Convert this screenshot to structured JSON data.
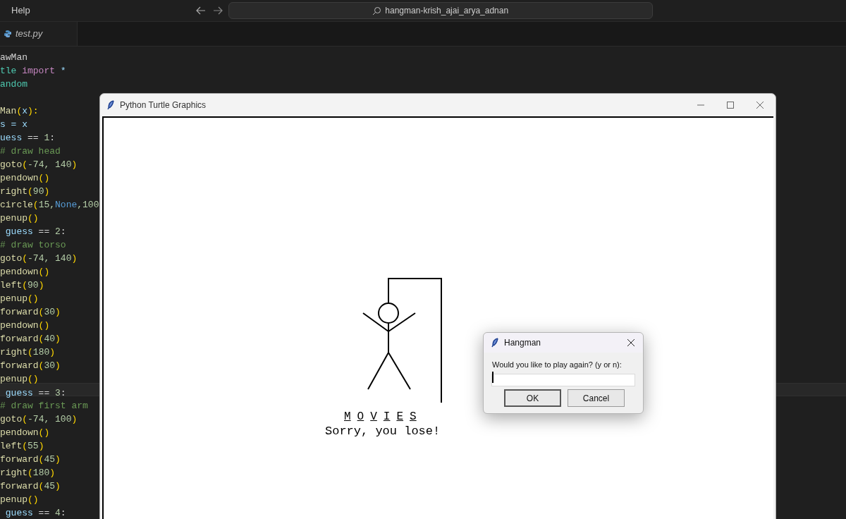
{
  "menu": {
    "items": [
      "Help"
    ]
  },
  "search": {
    "value": "hangman-krish_ajai_arya_adnan"
  },
  "tabs": [
    {
      "label": "test.py",
      "selected": true
    }
  ],
  "editor": {
    "lines": [
      {
        "selected": false,
        "tokens": [
          {
            "text": "awMan",
            "kind": "plain"
          }
        ]
      },
      {
        "selected": false,
        "tokens": [
          {
            "text": "tle ",
            "kind": "module"
          },
          {
            "text": "import",
            "kind": "keyword"
          },
          {
            "text": " *",
            "kind": "var"
          }
        ]
      },
      {
        "selected": false,
        "tokens": [
          {
            "text": "andom",
            "kind": "module"
          }
        ]
      },
      {
        "selected": false
      },
      {
        "selected": false,
        "tokens": [
          {
            "text": "Man",
            "kind": "fn"
          },
          {
            "text": "(",
            "kind": "paren"
          },
          {
            "text": "x",
            "kind": "var"
          },
          {
            "text": "):",
            "kind": "paren"
          }
        ]
      },
      {
        "selected": false,
        "tokens": [
          {
            "text": "s = x",
            "kind": "var"
          }
        ]
      },
      {
        "selected": false,
        "tokens": [
          {
            "text": "uess",
            "kind": "var"
          },
          {
            "text": " == ",
            "kind": "plain"
          },
          {
            "text": "1",
            "kind": "num"
          },
          {
            "text": ":",
            "kind": "plain"
          }
        ]
      },
      {
        "selected": false,
        "tokens": [
          {
            "text": "# draw head",
            "kind": "comment"
          }
        ]
      },
      {
        "selected": false,
        "tokens": [
          {
            "text": "goto",
            "kind": "fn"
          },
          {
            "text": "(",
            "kind": "paren"
          },
          {
            "text": "-74, 140",
            "kind": "num"
          },
          {
            "text": ")",
            "kind": "paren"
          }
        ]
      },
      {
        "selected": false,
        "tokens": [
          {
            "text": "pendown",
            "kind": "fn"
          },
          {
            "text": "()",
            "kind": "paren"
          }
        ]
      },
      {
        "selected": false,
        "tokens": [
          {
            "text": "right",
            "kind": "fn"
          },
          {
            "text": "(",
            "kind": "paren"
          },
          {
            "text": "90",
            "kind": "num"
          },
          {
            "text": ")",
            "kind": "paren"
          }
        ]
      },
      {
        "selected": false,
        "tokens": [
          {
            "text": "circle",
            "kind": "fn"
          },
          {
            "text": "(",
            "kind": "paren"
          },
          {
            "text": "15,",
            "kind": "num"
          },
          {
            "text": "None",
            "kind": "const"
          },
          {
            "text": ",100",
            "kind": "num"
          }
        ]
      },
      {
        "selected": false,
        "tokens": [
          {
            "text": "penup",
            "kind": "fn"
          },
          {
            "text": "()",
            "kind": "paren"
          }
        ]
      },
      {
        "selected": false,
        "tokens": [
          {
            "text": " guess",
            "kind": "var"
          },
          {
            "text": " == ",
            "kind": "plain"
          },
          {
            "text": "2",
            "kind": "num"
          },
          {
            "text": ":",
            "kind": "plain"
          }
        ]
      },
      {
        "selected": false,
        "tokens": [
          {
            "text": "# draw torso",
            "kind": "comment"
          }
        ]
      },
      {
        "selected": false,
        "tokens": [
          {
            "text": "goto",
            "kind": "fn"
          },
          {
            "text": "(",
            "kind": "paren"
          },
          {
            "text": "-74, 140",
            "kind": "num"
          },
          {
            "text": ")",
            "kind": "paren"
          }
        ]
      },
      {
        "selected": false,
        "tokens": [
          {
            "text": "pendown",
            "kind": "fn"
          },
          {
            "text": "()",
            "kind": "paren"
          }
        ]
      },
      {
        "selected": false,
        "tokens": [
          {
            "text": "left",
            "kind": "fn"
          },
          {
            "text": "(",
            "kind": "paren"
          },
          {
            "text": "90",
            "kind": "num"
          },
          {
            "text": ")",
            "kind": "paren"
          }
        ]
      },
      {
        "selected": false,
        "tokens": [
          {
            "text": "penup",
            "kind": "fn"
          },
          {
            "text": "()",
            "kind": "paren"
          }
        ]
      },
      {
        "selected": false,
        "tokens": [
          {
            "text": "forward",
            "kind": "fn"
          },
          {
            "text": "(",
            "kind": "paren"
          },
          {
            "text": "30",
            "kind": "num"
          },
          {
            "text": ")",
            "kind": "paren"
          }
        ]
      },
      {
        "selected": false,
        "tokens": [
          {
            "text": "pendown",
            "kind": "fn"
          },
          {
            "text": "()",
            "kind": "paren"
          }
        ]
      },
      {
        "selected": false,
        "tokens": [
          {
            "text": "forward",
            "kind": "fn"
          },
          {
            "text": "(",
            "kind": "paren"
          },
          {
            "text": "40",
            "kind": "num"
          },
          {
            "text": ")",
            "kind": "paren"
          }
        ]
      },
      {
        "selected": false,
        "tokens": [
          {
            "text": "right",
            "kind": "fn"
          },
          {
            "text": "(",
            "kind": "paren"
          },
          {
            "text": "180",
            "kind": "num"
          },
          {
            "text": ")",
            "kind": "paren"
          }
        ]
      },
      {
        "selected": false,
        "tokens": [
          {
            "text": "forward",
            "kind": "fn"
          },
          {
            "text": "(",
            "kind": "paren"
          },
          {
            "text": "30",
            "kind": "num"
          },
          {
            "text": ")",
            "kind": "paren"
          }
        ]
      },
      {
        "selected": false,
        "tokens": [
          {
            "text": "penup",
            "kind": "fn"
          },
          {
            "text": "()",
            "kind": "paren"
          }
        ]
      },
      {
        "selected": true,
        "tokens": [
          {
            "text": " guess",
            "kind": "var"
          },
          {
            "text": " == ",
            "kind": "plain"
          },
          {
            "text": "3",
            "kind": "num"
          },
          {
            "text": ":",
            "kind": "plain"
          }
        ]
      },
      {
        "selected": false,
        "tokens": [
          {
            "text": "# draw first arm",
            "kind": "comment"
          }
        ]
      },
      {
        "selected": false,
        "tokens": [
          {
            "text": "goto",
            "kind": "fn"
          },
          {
            "text": "(",
            "kind": "paren"
          },
          {
            "text": "-74, 100",
            "kind": "num"
          },
          {
            "text": ")",
            "kind": "paren"
          }
        ]
      },
      {
        "selected": false,
        "tokens": [
          {
            "text": "pendown",
            "kind": "fn"
          },
          {
            "text": "()",
            "kind": "paren"
          }
        ]
      },
      {
        "selected": false,
        "tokens": [
          {
            "text": "left",
            "kind": "fn"
          },
          {
            "text": "(",
            "kind": "paren"
          },
          {
            "text": "55",
            "kind": "num"
          },
          {
            "text": ")",
            "kind": "paren"
          }
        ]
      },
      {
        "selected": false,
        "tokens": [
          {
            "text": "forward",
            "kind": "fn"
          },
          {
            "text": "(",
            "kind": "paren"
          },
          {
            "text": "45",
            "kind": "num"
          },
          {
            "text": ")",
            "kind": "paren"
          }
        ]
      },
      {
        "selected": false,
        "tokens": [
          {
            "text": "right",
            "kind": "fn"
          },
          {
            "text": "(",
            "kind": "paren"
          },
          {
            "text": "180",
            "kind": "num"
          },
          {
            "text": ")",
            "kind": "paren"
          }
        ]
      },
      {
        "selected": false,
        "tokens": [
          {
            "text": "forward",
            "kind": "fn"
          },
          {
            "text": "(",
            "kind": "paren"
          },
          {
            "text": "45",
            "kind": "num"
          },
          {
            "text": ")",
            "kind": "paren"
          }
        ]
      },
      {
        "selected": false,
        "tokens": [
          {
            "text": "penup",
            "kind": "fn"
          },
          {
            "text": "()",
            "kind": "paren"
          }
        ]
      },
      {
        "selected": false,
        "tokens": [
          {
            "text": " guess",
            "kind": "var"
          },
          {
            "text": " == ",
            "kind": "plain"
          },
          {
            "text": "4",
            "kind": "num"
          },
          {
            "text": ":",
            "kind": "plain"
          }
        ]
      }
    ]
  },
  "turtle_window": {
    "title": "Python Turtle Graphics",
    "word_letters": [
      "M",
      "O",
      "V",
      "I",
      "E",
      "S"
    ],
    "message": "Sorry, you lose!"
  },
  "dialog": {
    "title": "Hangman",
    "prompt": "Would you like to play again? (y or n):",
    "input": {
      "focused": true
    },
    "buttons": [
      {
        "label": "OK",
        "focused": true
      },
      {
        "label": "Cancel",
        "focused": false
      }
    ]
  }
}
